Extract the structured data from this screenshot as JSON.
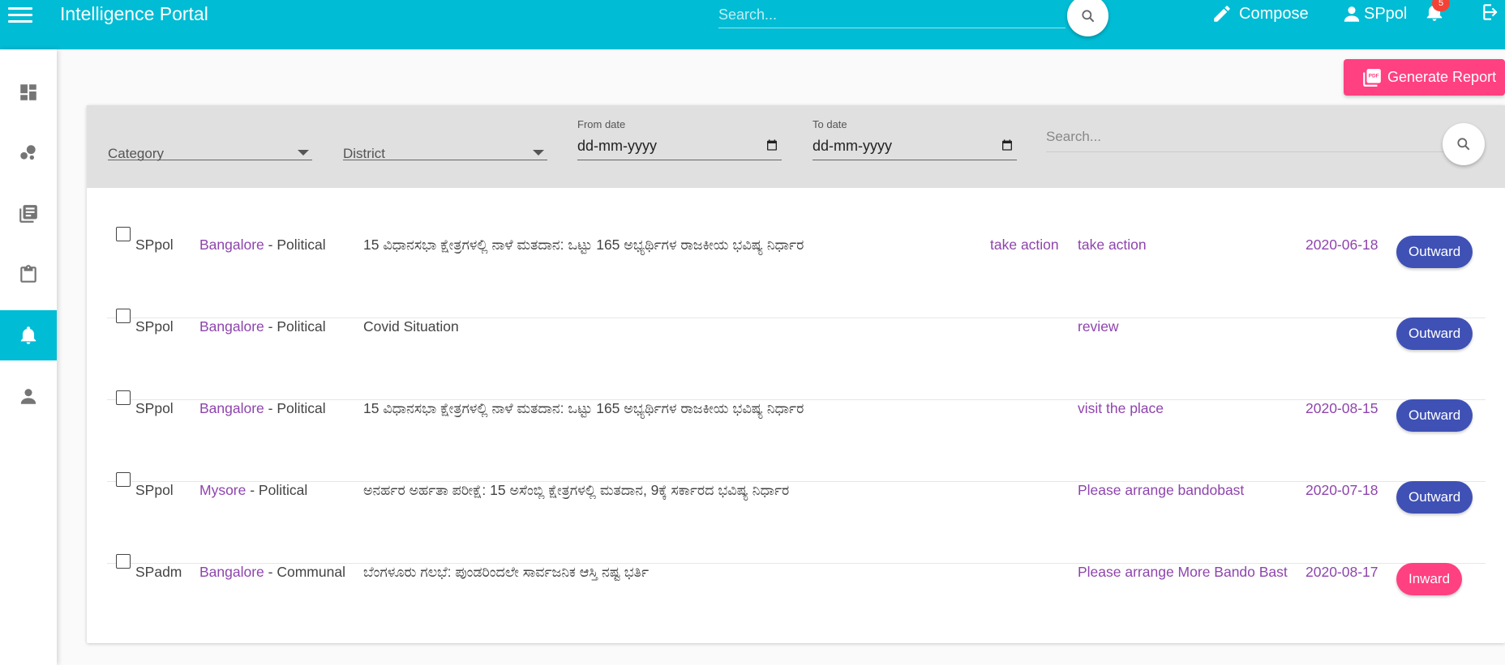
{
  "app": {
    "title": "Intelligence Portal",
    "search_placeholder": "Search...",
    "compose_label": "Compose",
    "user_name": "SPpol",
    "notification_count": "5"
  },
  "sidebar": {
    "items": [
      {
        "icon": "dashboard-icon",
        "active": false
      },
      {
        "icon": "bubble-chart-icon",
        "active": false
      },
      {
        "icon": "library-books-icon",
        "active": false
      },
      {
        "icon": "clipboard-icon",
        "active": false
      },
      {
        "icon": "bell-icon",
        "active": true
      },
      {
        "icon": "person-icon",
        "active": false
      }
    ]
  },
  "actions": {
    "generate_report_label": "Generate Report"
  },
  "filters": {
    "category_label": "Category",
    "district_label": "District",
    "from_date_label": "From date",
    "from_date_value": "dd-mm-yyyy",
    "to_date_label": "To date",
    "to_date_value": "dd-mm-yyyy",
    "search_placeholder": "Search..."
  },
  "rows": [
    {
      "user": "SPpol",
      "district": "Bangalore",
      "category": " - Political",
      "subject": "15 ವಿಧಾನಸಭಾ ಕ್ಷೇತ್ರಗಳಲ್ಲಿ ನಾಳೆ ಮತದಾನ: ಒಟ್ಟು 165 ಅಭ್ಯರ್ಥಿಗಳ ರಾಜಕೀಯ ಭವಿಷ್ಯ ನಿರ್ಧಾರ",
      "note1": "take action",
      "note2": "take action",
      "date": "2020-06-18",
      "direction": "Outward"
    },
    {
      "user": "SPpol",
      "district": "Bangalore",
      "category": " - Political",
      "subject": "Covid Situation",
      "note1": "",
      "note2": "review",
      "date": "",
      "direction": "Outward"
    },
    {
      "user": "SPpol",
      "district": "Bangalore",
      "category": " - Political",
      "subject": "15 ವಿಧಾನಸಭಾ ಕ್ಷೇತ್ರಗಳಲ್ಲಿ ನಾಳೆ ಮತದಾನ: ಒಟ್ಟು 165 ಅಭ್ಯರ್ಥಿಗಳ ರಾಜಕೀಯ ಭವಿಷ್ಯ ನಿರ್ಧಾರ",
      "note1": "",
      "note2": "visit the place",
      "date": "2020-08-15",
      "direction": "Outward"
    },
    {
      "user": "SPpol",
      "district": "Mysore",
      "category": " - Political",
      "subject": "ಅನರ್ಹರ ಅರ್ಹತಾ ಪರೀಕ್ಷೆ: 15 ಅಸೆಂಬ್ಲಿ ಕ್ಷೇತ್ರಗಳಲ್ಲಿ ಮತದಾನ, 9ಕ್ಕೆ ಸರ್ಕಾರದ ಭವಿಷ್ಯ ನಿರ್ಧಾರ",
      "note1": "",
      "note2": "Please arrange bandobast",
      "date": "2020-07-18",
      "direction": "Outward"
    },
    {
      "user": "SPadm",
      "district": "Bangalore",
      "category": " - Communal",
      "subject": "ಬೆಂಗಳೂರು ಗಲಭೆ: ಪುಂಡರಿಂದಲೇ ಸಾರ್ವಜನಿಕ ಆಸ್ತಿ ನಷ್ಟ ಭರ್ತಿ",
      "note1": "",
      "note2": "Please arrange More Bando Bast",
      "date": "2020-08-17",
      "direction": "Inward"
    }
  ],
  "colors": {
    "primary": "#00bcd4",
    "accent": "#ff4081",
    "outward": "#3f51b5",
    "link": "#8e44ad"
  }
}
